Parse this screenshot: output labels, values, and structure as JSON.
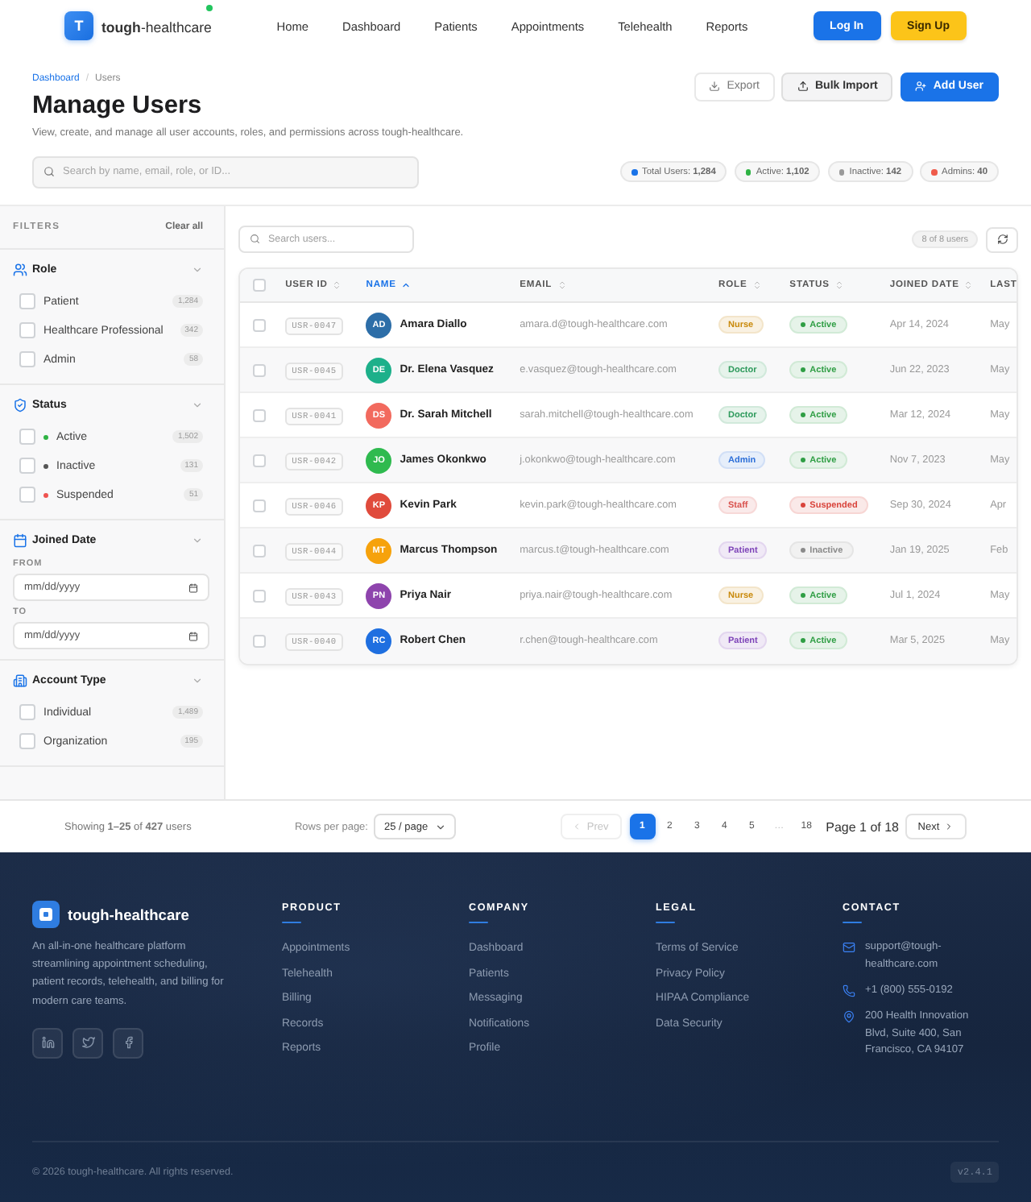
{
  "header": {
    "logo_letter": "T",
    "brand": "**tough**-healthcare",
    "nav": [
      "Home",
      "Dashboard",
      "Patients",
      "Appointments",
      "Telehealth",
      "Reports"
    ],
    "login": "Log In",
    "signup": "Sign Up"
  },
  "page": {
    "breadcrumb": [
      {
        "label": "Dashboard",
        "kind": "link"
      },
      {
        "label": "Users",
        "kind": "current"
      }
    ],
    "breadcrumb_separator": "/",
    "title": "Manage Users",
    "subtitle": "View, create, and manage all user accounts, roles, and permissions across tough-healthcare.",
    "actions": [
      {
        "label": "Export",
        "kind": "outline"
      },
      {
        "label": "Bulk Import",
        "kind": "secondary"
      },
      {
        "label": "Add User",
        "kind": "primary"
      }
    ],
    "search": {
      "placeholder": "Search by name, email, role, or ID..."
    },
    "stats": [
      {
        "text": "Total Users: **1,284**",
        "color": "#1a73e8"
      },
      {
        "text": "Active: **1,102**",
        "color": "#2fb344"
      },
      {
        "text": "Inactive: **142**",
        "color": "#9a9a9a"
      },
      {
        "text": "Admins: **40**",
        "color": "#ef5b4b"
      }
    ]
  },
  "filters": {
    "title": "FILTERS",
    "clear": "Clear all",
    "sections": [
      {
        "title": "Role",
        "kind": "checklist",
        "expanded": true,
        "items": [
          {
            "label": "Patient",
            "count": "1,284",
            "checked": false
          },
          {
            "label": "Healthcare Professional",
            "count": "342",
            "checked": false
          },
          {
            "label": "Admin",
            "count": "58",
            "checked": false
          }
        ]
      },
      {
        "title": "Status",
        "kind": "checklist",
        "expanded": true,
        "items": [
          {
            "label": "Active",
            "count": "1,502",
            "checked": false,
            "color": "#2fb344"
          },
          {
            "label": "Inactive",
            "count": "131",
            "checked": false,
            "color": "#555555"
          },
          {
            "label": "Suspended",
            "count": "51",
            "checked": false,
            "color": "#ef5350"
          }
        ]
      },
      {
        "title": "Joined Date",
        "kind": "dates",
        "expanded": true,
        "fields": [
          {
            "label": "FROM",
            "placeholder": "mm/dd/yyyy"
          },
          {
            "label": "TO",
            "placeholder": "mm/dd/yyyy"
          }
        ]
      },
      {
        "title": "Account Type",
        "kind": "checklist",
        "expanded": true,
        "items": [
          {
            "label": "Individual",
            "count": "1,489",
            "checked": false
          },
          {
            "label": "Organization",
            "count": "195",
            "checked": false
          }
        ]
      }
    ]
  },
  "table": {
    "search": {
      "placeholder": "Search users..."
    },
    "count": "8 of 8 users",
    "select_all": {
      "checked": false
    },
    "columns": [
      {
        "label": "USER ID",
        "sorted": false
      },
      {
        "label": "NAME",
        "sorted": true
      },
      {
        "label": "EMAIL",
        "sorted": false
      },
      {
        "label": "ROLE",
        "sorted": false
      },
      {
        "label": "STATUS",
        "sorted": false
      },
      {
        "label": "JOINED DATE",
        "sorted": false
      },
      {
        "label": "LAST"
      }
    ],
    "rows": [
      {
        "checked": false,
        "id": "USR-0047",
        "avatar": {
          "initials": "AD",
          "color": "#2d6ea8"
        },
        "name": "Amara Diallo",
        "email": "amara.d@tough-healthcare.com",
        "role": {
          "label": "Nurse",
          "color": "#c98a0c"
        },
        "status": {
          "label": "Active",
          "color": "#2f9e44"
        },
        "joined": "Apr 14, 2024",
        "last": "May"
      },
      {
        "checked": false,
        "id": "USR-0045",
        "avatar": {
          "initials": "DE",
          "color": "#1db08a"
        },
        "name": "Dr. Elena Vasquez",
        "email": "e.vasquez@tough-healthcare.com",
        "role": {
          "label": "Doctor",
          "color": "#2e9a5c"
        },
        "status": {
          "label": "Active",
          "color": "#2f9e44"
        },
        "joined": "Jun 22, 2023",
        "last": "May"
      },
      {
        "checked": false,
        "id": "USR-0041",
        "avatar": {
          "initials": "DS",
          "color": "#f26a5e"
        },
        "name": "Dr. Sarah Mitchell",
        "email": "sarah.mitchell@tough-healthcare.com",
        "role": {
          "label": "Doctor",
          "color": "#2e9a5c"
        },
        "status": {
          "label": "Active",
          "color": "#2f9e44"
        },
        "joined": "Mar 12, 2024",
        "last": "May"
      },
      {
        "checked": false,
        "id": "USR-0042",
        "avatar": {
          "initials": "JO",
          "color": "#2fba4f"
        },
        "name": "James Okonkwo",
        "email": "j.okonkwo@tough-healthcare.com",
        "role": {
          "label": "Admin",
          "color": "#2d6fd8"
        },
        "status": {
          "label": "Active",
          "color": "#2f9e44"
        },
        "joined": "Nov 7, 2023",
        "last": "May"
      },
      {
        "checked": false,
        "id": "USR-0046",
        "avatar": {
          "initials": "KP",
          "color": "#e04b3c"
        },
        "name": "Kevin Park",
        "email": "kevin.park@tough-healthcare.com",
        "role": {
          "label": "Staff",
          "color": "#d9534f"
        },
        "status": {
          "label": "Suspended",
          "color": "#d9443c"
        },
        "joined": "Sep 30, 2024",
        "last": "Apr"
      },
      {
        "checked": false,
        "id": "USR-0044",
        "avatar": {
          "initials": "MT",
          "color": "#f6a20c"
        },
        "name": "Marcus Thompson",
        "email": "marcus.t@tough-healthcare.com",
        "role": {
          "label": "Patient",
          "color": "#7e44b8"
        },
        "status": {
          "label": "Inactive",
          "color": "#8a8a8a"
        },
        "joined": "Jan 19, 2025",
        "last": "Feb"
      },
      {
        "checked": false,
        "id": "USR-0043",
        "avatar": {
          "initials": "PN",
          "color": "#8e44ad"
        },
        "name": "Priya Nair",
        "email": "priya.nair@tough-healthcare.com",
        "role": {
          "label": "Nurse",
          "color": "#c98a0c"
        },
        "status": {
          "label": "Active",
          "color": "#2f9e44"
        },
        "joined": "Jul 1, 2024",
        "last": "May"
      },
      {
        "checked": false,
        "id": "USR-0040",
        "avatar": {
          "initials": "RC",
          "color": "#1f6fe0"
        },
        "name": "Robert Chen",
        "email": "r.chen@tough-healthcare.com",
        "role": {
          "label": "Patient",
          "color": "#7e44b8"
        },
        "status": {
          "label": "Active",
          "color": "#2f9e44"
        },
        "joined": "Mar 5, 2025",
        "last": "May"
      }
    ]
  },
  "pagination": {
    "summary": "Showing **1–25** of **427** users",
    "rows_label": "Rows per page:",
    "rows_value": "25 / page",
    "prev": {
      "label": "Prev",
      "disabled": true
    },
    "pages": [
      {
        "label": "1",
        "kind": "page",
        "selected": true
      },
      {
        "label": "2",
        "kind": "page",
        "selected": false
      },
      {
        "label": "3",
        "kind": "page",
        "selected": false
      },
      {
        "label": "4",
        "kind": "page",
        "selected": false
      },
      {
        "label": "5",
        "kind": "page",
        "selected": false
      },
      {
        "label": "…",
        "kind": "ellipsis",
        "selected": false
      },
      {
        "label": "18",
        "kind": "page",
        "selected": false
      }
    ],
    "page_info": "Page 1 of 18",
    "next": {
      "label": "Next",
      "disabled": false
    }
  },
  "footer": {
    "brand": "tough-healthcare",
    "description": "An all-in-one healthcare platform streamlining appointment scheduling, patient records, telehealth, and billing for modern care teams.",
    "columns": [
      {
        "title": "PRODUCT",
        "links": [
          "Appointments",
          "Telehealth",
          "Billing",
          "Records",
          "Reports"
        ]
      },
      {
        "title": "COMPANY",
        "links": [
          "Dashboard",
          "Patients",
          "Messaging",
          "Notifications",
          "Profile"
        ]
      },
      {
        "title": "LEGAL",
        "links": [
          "Terms of Service",
          "Privacy Policy",
          "HIPAA Compliance",
          "Data Security"
        ]
      }
    ],
    "contact": {
      "title": "CONTACT",
      "items": [
        {
          "kind": "email",
          "text": "support@tough-healthcare.com"
        },
        {
          "kind": "phone",
          "text": "+1 (800) 555-0192"
        },
        {
          "kind": "address",
          "text": "200 Health Innovation Blvd, Suite 400, San Francisco, CA 94107"
        }
      ]
    },
    "copyright": "© 2026 tough-healthcare. All rights reserved.",
    "version": "v2.4.1"
  }
}
